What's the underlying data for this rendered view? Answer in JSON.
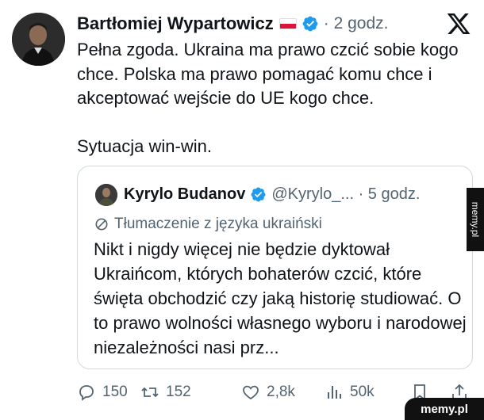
{
  "tweet": {
    "author_name": "Bartłomiej Wypartowicz",
    "meta": "· 2 godz.",
    "text": "Pełna zgoda. Ukraina ma prawo czcić sobie kogo chce. Polska ma prawo pomagać komu chce i akceptować wejście do UE kogo chce.\n\nSytuacja win-win."
  },
  "quote": {
    "author_name": "Kyrylo Budanov",
    "meta": "@Kyrylo_... · 5 godz.",
    "translation_label": "Tłumaczenie z języka ukraiński",
    "text": "Nikt i nigdy więcej nie będzie dyktował Ukraińcom, których bohaterów czcić, które święta obchodzić czy jaką historię studiować. O to prawo wolności własnego wyboru i narodowej niezależności nasi prz..."
  },
  "actions": {
    "replies": "150",
    "reposts": "152",
    "likes": "2,8k",
    "views": "50k"
  },
  "watermark": {
    "side": "memy.pl",
    "corner": "memy.pl"
  },
  "colors": {
    "text": "#0f1419",
    "muted": "#536471",
    "verified": "#1d9bf0",
    "border": "#cfd9de"
  },
  "icons": [
    "x-logo-icon",
    "verified-badge-icon",
    "poland-flag-icon",
    "translate-icon",
    "reply-icon",
    "repost-icon",
    "like-icon",
    "views-icon",
    "bookmark-icon",
    "share-icon"
  ]
}
